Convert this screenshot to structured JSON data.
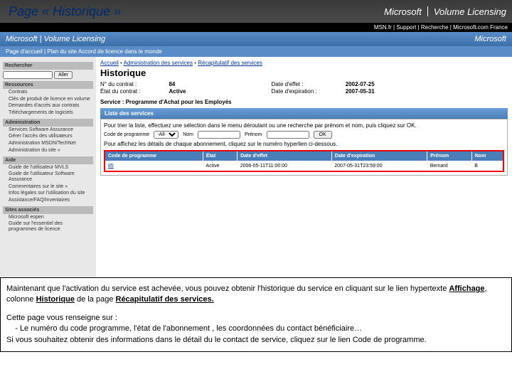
{
  "header": {
    "title": "Page « Historique »",
    "brand": "Microsoft",
    "product": "Volume Licensing",
    "blacknav": "MSN.fr  |  Support  |  Recherche  |  Microsoft.com  France"
  },
  "subheader": {
    "brand": "Microsoft",
    "product": "Volume Licensing",
    "right": "Microsoft"
  },
  "subnav": "Page d'accueil | Plan du site    Accord de licence dans le monde",
  "sidebar": {
    "search_hdr": "Rechercher",
    "search_btn": "Aller",
    "groups": [
      {
        "hdr": "Ressources",
        "items": [
          "Contrats",
          "Clés de produit de licence en volume",
          "Demandes d'accès aux contrats",
          "Téléchargements de logiciels"
        ]
      },
      {
        "hdr": "Administration",
        "items": [
          "Services Software Assurance",
          "Gérer l'accès des utilisateurs",
          "Administration MSDN/TechNet",
          "Administration du site  »"
        ]
      },
      {
        "hdr": "Aide",
        "items": [
          "Guide de l'utilisateur MVLS",
          "Guide de l'utilisateur Software Assurance",
          "Commentaires sur le site  »",
          "Infos légales sur l'utilisation du site",
          "Assistance/FAQ/Inventaires"
        ]
      },
      {
        "hdr": "Sites associés",
        "items": [
          "Microsoft eopen",
          "Guide sur l'essentiel des programmes de licence"
        ]
      }
    ]
  },
  "content": {
    "breadcrumb1": "Accueil",
    "breadcrumb2": "Administration des services",
    "breadcrumb3": "Récapitulatif des services",
    "h1": "Historique",
    "info_left_lbl1": "N° du contrat :",
    "info_left_val1": "84",
    "info_left_lbl2": "État du contrat :",
    "info_left_val2": "Active",
    "info_right_lbl1": "Date d'effet :",
    "info_right_val1": "2002-07-25",
    "info_right_lbl2": "Date d'expiration :",
    "info_right_val2": "2007-05-31",
    "service_line": "Service :  Programme d'Achat pour les Employés",
    "panel_hdr": "Liste des services",
    "instr1": "Pour trier la liste, effectuez une sélection dans le menu déroulant ou une recherche par prénom et nom, puis cliquez sur OK.",
    "filter_lbl": "Code de programme",
    "filter_sel": "-All-",
    "filter_nom_lbl": "Nom",
    "filter_pre_lbl": "Prénom",
    "filter_ok": "OK",
    "instr2": "Pour affichez les détails de chaque abonnement, cliquez sur le numéro hyperlien ci-dessous.",
    "cols": [
      "Code de programme",
      "État",
      "Date d'effet",
      "Date d'expiration",
      "Prénom",
      "Nom"
    ],
    "row": [
      "85",
      "Active",
      "2006-05-11T11:00:00",
      "2007-05-31T23:59:00",
      "Bernard",
      "B"
    ]
  },
  "explain": {
    "p1a": "Maintenant que l'activation du service est achevée, vous pouvez obtenir l'historique du service en cliquant sur le lien hypertexte ",
    "p1b": "Affichage",
    "p1c": ", colonne ",
    "p1d": "Historique",
    "p1e": " de la page ",
    "p1f": "Récapitulatif des services.",
    "p2": "Cette page vous renseigne sur :",
    "p3": "    - Le numéro du code programme, l'état de l'abonnement , les coordonnées du contact bénéficiaire…",
    "p4": "Si vous souhaitez obtenir des informations dans le détail du le contact de service, cliquez sur le lien Code de programme."
  }
}
